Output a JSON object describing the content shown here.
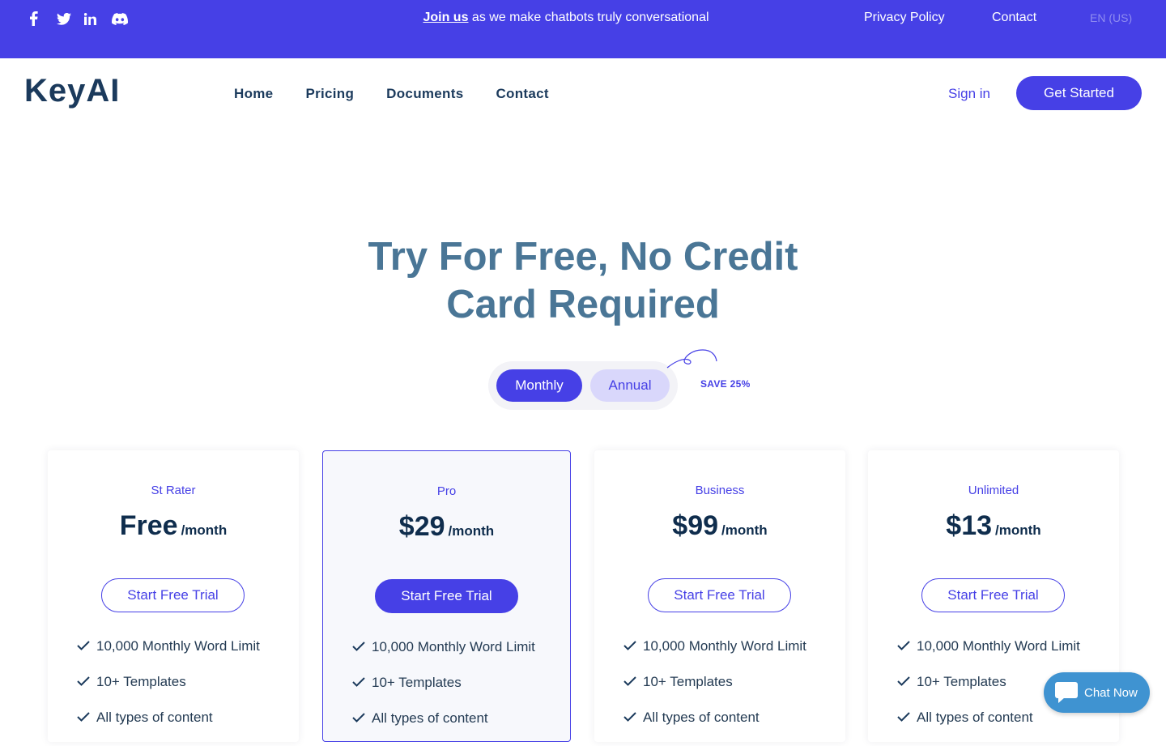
{
  "topbar": {
    "socials": [
      "facebook-icon",
      "twitter-icon",
      "linkedin-icon",
      "discord-icon"
    ],
    "promo_link": "Join us",
    "promo_text": " as we make chatbots truly conversational",
    "privacy": "Privacy Policy",
    "contact": "Contact",
    "language": "EN (US)"
  },
  "nav": {
    "logo": "KeyAI",
    "links": [
      "Home",
      "Pricing",
      "Documents",
      "Contact"
    ],
    "signin": "Sign in",
    "get_started": "Get Started"
  },
  "hero": {
    "title_line1": "Try For Free, No Credit",
    "title_line2": "Card Required"
  },
  "billing_toggle": {
    "monthly": "Monthly",
    "annual": "Annual",
    "selected": "Monthly",
    "save_label": "SAVE 25%"
  },
  "plans": [
    {
      "name": "St Rater",
      "price": "Free",
      "period": "/month",
      "cta": "Start Free Trial",
      "featured": false,
      "features": [
        "10,000 Monthly Word Limit",
        "10+ Templates",
        "All types of content"
      ]
    },
    {
      "name": "Pro",
      "price": "$29",
      "period": "/month",
      "cta": "Start Free Trial",
      "featured": true,
      "features": [
        "10,000 Monthly Word Limit",
        "10+ Templates",
        "All types of content"
      ]
    },
    {
      "name": "Business",
      "price": "$99",
      "period": "/month",
      "cta": "Start Free Trial",
      "featured": false,
      "features": [
        "10,000 Monthly Word Limit",
        "10+ Templates",
        "All types of content"
      ]
    },
    {
      "name": "Unlimited",
      "price": "$13",
      "period": "/month",
      "cta": "Start Free Trial",
      "featured": false,
      "features": [
        "10,000 Monthly Word Limit",
        "10+ Templates",
        "All types of content"
      ]
    }
  ],
  "chat": {
    "label": "Chat Now"
  },
  "colors": {
    "brand": "#4640e6",
    "heading": "#4a7696",
    "dark_text": "#0f2d4d",
    "chat": "#3f93d1"
  }
}
